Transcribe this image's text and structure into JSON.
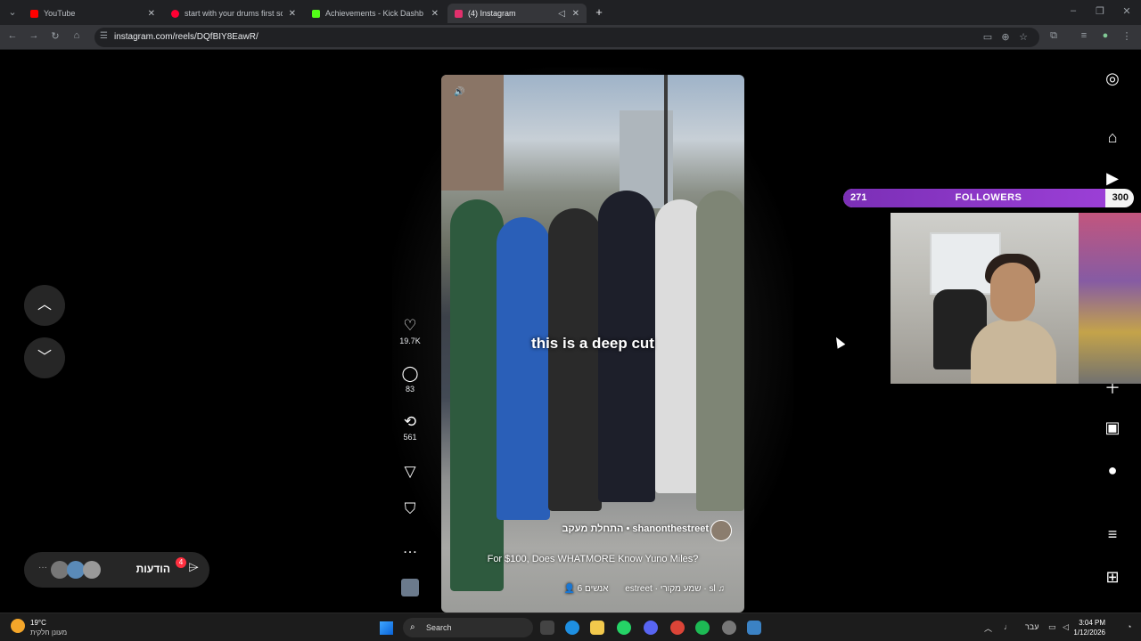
{
  "browser": {
    "tabs": [
      {
        "title": "YouTube",
        "color": "#ff0000"
      },
      {
        "title": "start with your drums first som",
        "color": "#ff0033"
      },
      {
        "title": "Achievements - Kick Dashboard",
        "color": "#53fc18"
      },
      {
        "title": "(4) Instagram",
        "color": "#e1306c"
      }
    ],
    "new_tab": "+",
    "url": "instagram.com/reels/DQfBIY8EawR/"
  },
  "reel": {
    "caption": "this is a deep cut",
    "username": "shanonthestreet",
    "follow_label": "התחלת מעקב",
    "description": "For $100, Does WHATMORE Know Yuno Miles?",
    "people_label": "6 אנשים",
    "audio_label": "estreet · שמע מקורי · sl",
    "actions": {
      "likes": "19.7K",
      "comments": "83",
      "reposts": "561"
    }
  },
  "notifications": {
    "label": "הודעות",
    "badge": "4"
  },
  "overlay": {
    "followers_current": "271",
    "followers_label": "FOLLOWERS",
    "followers_goal": "300",
    "progress_fraction": 0.903
  },
  "taskbar": {
    "temperature": "19°C",
    "weather_desc": "מעונן חלקית",
    "search_label": "Search",
    "language": "עבר",
    "time": "3:04 PM",
    "date": "1/12/2026"
  }
}
